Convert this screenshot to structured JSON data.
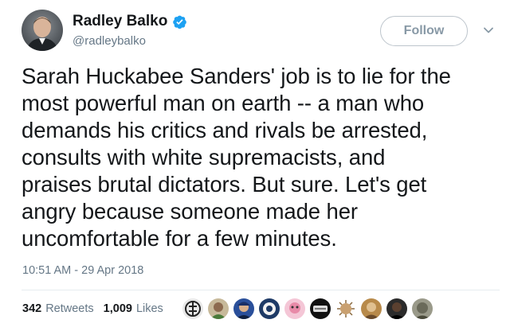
{
  "author": {
    "display_name": "Radley Balko",
    "handle": "@radleybalko",
    "verified": true,
    "avatar_icon": "profile-photo"
  },
  "follow_button": {
    "label": "Follow"
  },
  "more_menu_icon": "chevron-down-icon",
  "tweet": {
    "lines": [
      "Sarah Huckabee Sanders' job is to lie for the",
      "most powerful man on earth -- a man who",
      "demands his critics and rivals be arrested,",
      "consults with white supremacists, and",
      "praises brutal dictators. But sure. Let's get",
      "angry because someone made her",
      "uncomfortable for a few minutes."
    ],
    "timestamp": "10:51 AM - 29 Apr 2018"
  },
  "stats": {
    "retweets_count": "342",
    "retweets_label": "Retweets",
    "likes_count": "1,009",
    "likes_label": "Likes"
  },
  "liker_avatars_count": 10,
  "colors": {
    "text": "#14171a",
    "secondary": "#657786",
    "verified_blue": "#1da1f2",
    "divider": "#e6ecf0",
    "follow_border": "#bdc5cc"
  }
}
